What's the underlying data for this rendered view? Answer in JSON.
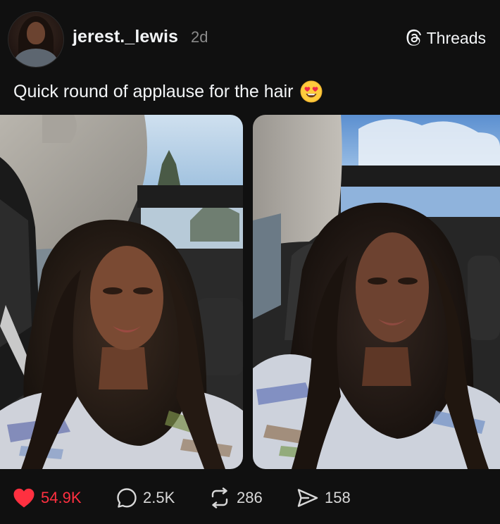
{
  "post": {
    "username": "jerest._lewis",
    "time_ago": "2d",
    "caption": "Quick round of applause for the hair",
    "caption_emoji": "smiling-face-with-heart-eyes"
  },
  "brand": {
    "label": "Threads",
    "icon": "threads-logo-icon"
  },
  "media": [
    {
      "kind": "photo",
      "subject": "selfie-in-car-left"
    },
    {
      "kind": "photo",
      "subject": "selfie-in-car-right"
    }
  ],
  "actions": {
    "likes": "54.9K",
    "replies": "2.5K",
    "reposts": "286",
    "shares": "158"
  },
  "colors": {
    "background": "#101010",
    "text_primary": "#f3f5f7",
    "text_secondary": "#8a8a8a",
    "like_active": "#ff3040"
  }
}
